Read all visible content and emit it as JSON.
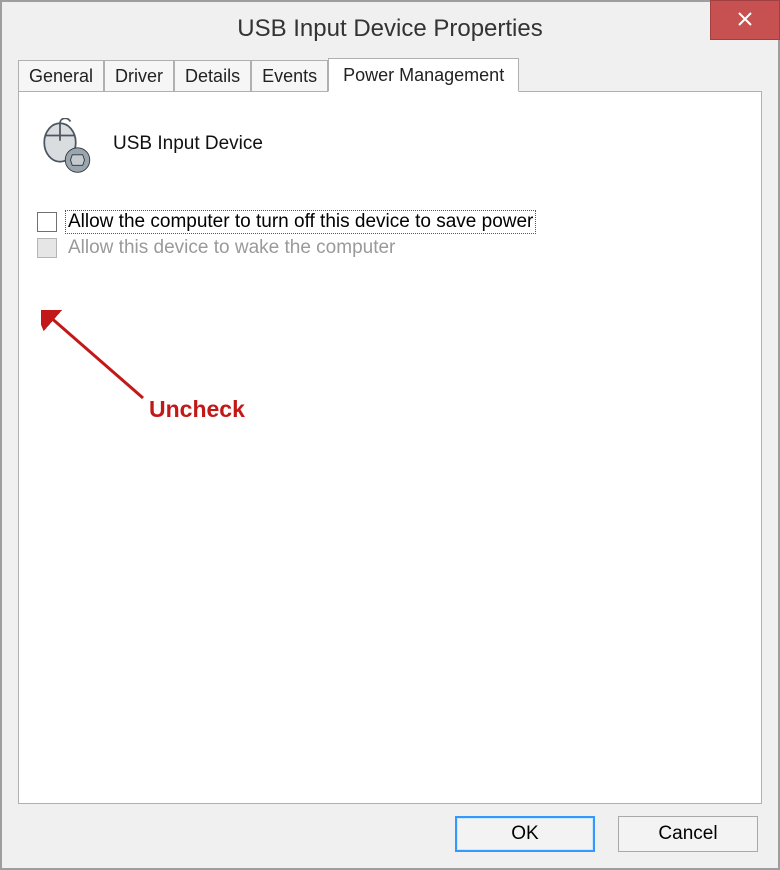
{
  "window": {
    "title": "USB Input Device Properties"
  },
  "tabs": [
    {
      "label": "General"
    },
    {
      "label": "Driver"
    },
    {
      "label": "Details"
    },
    {
      "label": "Events"
    },
    {
      "label": "Power Management"
    }
  ],
  "device": {
    "name": "USB Input Device"
  },
  "options": {
    "allow_turn_off": {
      "label": "Allow the computer to turn off this device to save power",
      "checked": false,
      "enabled": true
    },
    "allow_wake": {
      "label": "Allow this device to wake the computer",
      "checked": false,
      "enabled": false
    }
  },
  "buttons": {
    "ok": "OK",
    "cancel": "Cancel"
  },
  "annotation": {
    "text": "Uncheck",
    "color": "#c21818"
  }
}
